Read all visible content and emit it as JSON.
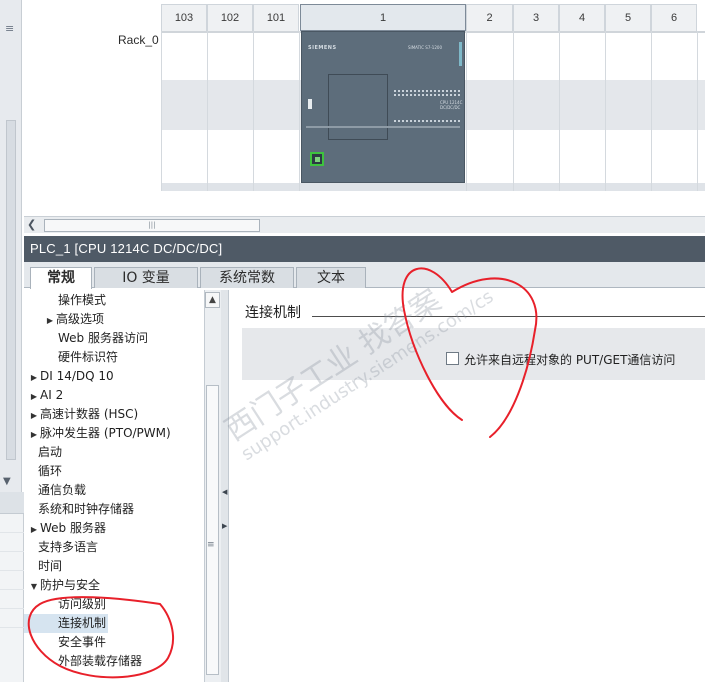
{
  "device_view": {
    "rack_label": "Rack_0",
    "slots": [
      "103",
      "102",
      "101",
      "1",
      "2",
      "3",
      "4",
      "5",
      "6"
    ],
    "cpu": {
      "brand": "SIEMENS",
      "model": "SIMATIC S7-1200",
      "model2_line1": "CPU 1214C",
      "model2_line2": "DC/DC/DC"
    }
  },
  "properties": {
    "title": "PLC_1 [CPU 1214C DC/DC/DC]",
    "tabs": [
      "常规",
      "IO 变量",
      "系统常数",
      "文本"
    ],
    "active_tab": "常规",
    "tree": [
      {
        "label": "操作模式",
        "level": 1,
        "expand": false
      },
      {
        "label": "高级选项",
        "level": 1,
        "expand": true
      },
      {
        "label": "Web 服务器访问",
        "level": 1,
        "expand": false
      },
      {
        "label": "硬件标识符",
        "level": 1,
        "expand": false
      },
      {
        "label": "DI 14/DQ 10",
        "level": 0,
        "expand": true
      },
      {
        "label": "AI 2",
        "level": 0,
        "expand": true
      },
      {
        "label": "高速计数器 (HSC)",
        "level": 0,
        "expand": true
      },
      {
        "label": "脉冲发生器 (PTO/PWM)",
        "level": 0,
        "expand": true
      },
      {
        "label": "启动",
        "level": 0,
        "expand": false
      },
      {
        "label": "循环",
        "level": 0,
        "expand": false
      },
      {
        "label": "通信负载",
        "level": 0,
        "expand": false
      },
      {
        "label": "系统和时钟存储器",
        "level": 0,
        "expand": false
      },
      {
        "label": "Web 服务器",
        "level": 0,
        "expand": true
      },
      {
        "label": "支持多语言",
        "level": 0,
        "expand": false
      },
      {
        "label": "时间",
        "level": 0,
        "expand": false
      },
      {
        "label": "防护与安全",
        "level": 0,
        "expand": true,
        "open": true
      },
      {
        "label": "访问级别",
        "level": 1,
        "expand": false
      },
      {
        "label": "连接机制",
        "level": 1,
        "expand": false,
        "selected": true
      },
      {
        "label": "安全事件",
        "level": 1,
        "expand": false
      },
      {
        "label": "外部装载存储器",
        "level": 1,
        "expand": false
      }
    ],
    "section": {
      "title": "连接机制",
      "checkbox_label": "允许来自远程对象的 PUT/GET通信访问",
      "checked": false
    }
  },
  "watermark": {
    "line1": "西门子工业 找答案",
    "line2": "support.industry.siemens.com/cs"
  },
  "colors": {
    "title_bar": "#4f5a66",
    "cpu_body": "#5d6d7b",
    "selection": "#d6e4f0",
    "annotation_red": "#e8202a"
  }
}
